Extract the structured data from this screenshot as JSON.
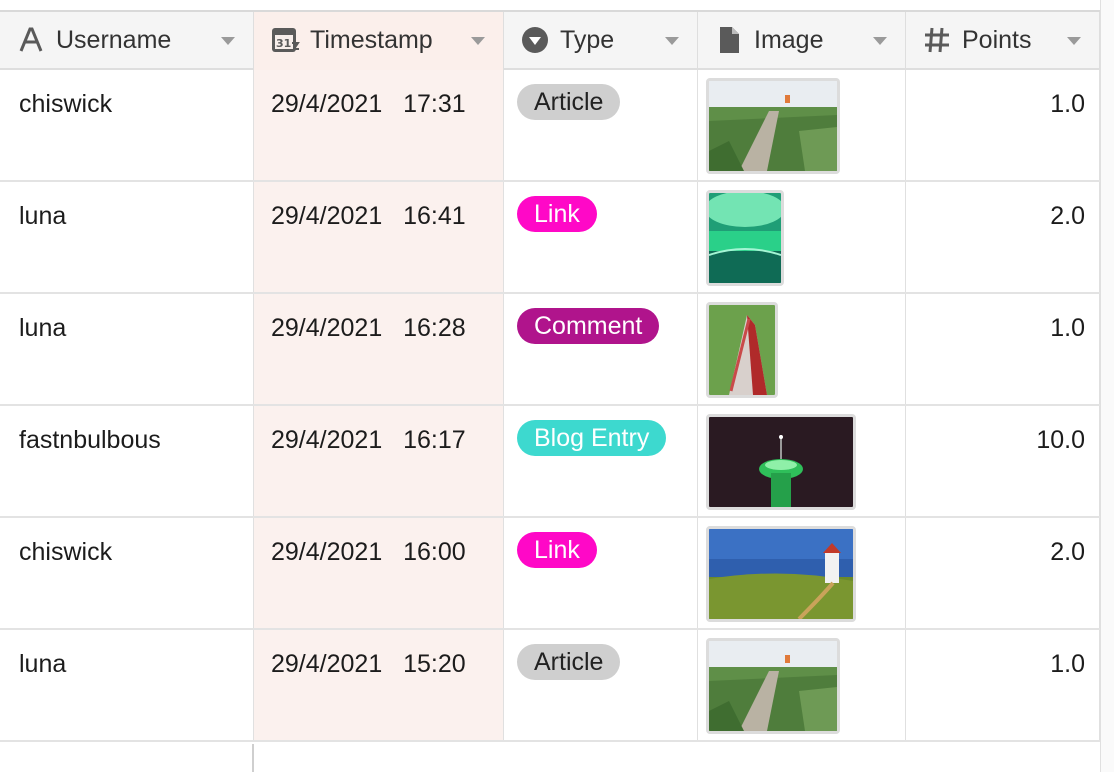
{
  "columns": {
    "username": {
      "label": "Username",
      "icon": "text-field-icon"
    },
    "timestamp": {
      "label": "Timestamp",
      "icon": "calendar-formula-icon",
      "badge": "31"
    },
    "type": {
      "label": "Type",
      "icon": "single-select-icon"
    },
    "image": {
      "label": "Image",
      "icon": "attachment-file-icon"
    },
    "points": {
      "label": "Points",
      "icon": "number-hash-icon"
    }
  },
  "colors": {
    "article": "#cfcfcf",
    "link": "#ff08c7",
    "comment": "#b0148c",
    "blog_entry": "#3dd9cf",
    "timestamp_bg": "#fbf1ee"
  },
  "rows": [
    {
      "username": "chiswick",
      "date": "29/4/2021",
      "time": "17:31",
      "type": "Article",
      "image": "boardwalk-grass-thumbnail",
      "points": "1.0"
    },
    {
      "username": "luna",
      "date": "29/4/2021",
      "time": "16:41",
      "type": "Link",
      "image": "green-tunnel-thumbnail",
      "points": "2.0"
    },
    {
      "username": "luna",
      "date": "29/4/2021",
      "time": "16:28",
      "type": "Comment",
      "image": "red-tower-thumbnail",
      "points": "1.0"
    },
    {
      "username": "fastnbulbous",
      "date": "29/4/2021",
      "time": "16:17",
      "type": "Blog Entry",
      "image": "green-lit-tower-night-thumbnail",
      "points": "10.0"
    },
    {
      "username": "chiswick",
      "date": "29/4/2021",
      "time": "16:00",
      "type": "Link",
      "image": "lighthouse-meadow-thumbnail",
      "points": "2.0"
    },
    {
      "username": "luna",
      "date": "29/4/2021",
      "time": "15:20",
      "type": "Article",
      "image": "boardwalk-grass-thumbnail",
      "points": "1.0"
    }
  ]
}
